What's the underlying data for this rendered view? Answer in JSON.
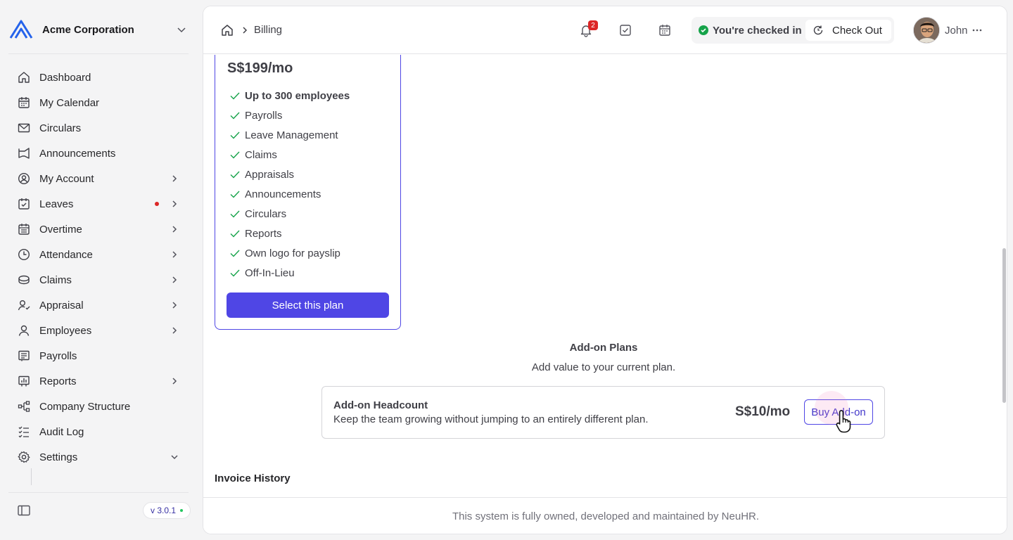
{
  "org": {
    "name": "Acme Corporation"
  },
  "sidebar": {
    "items": [
      {
        "label": "Dashboard",
        "icon": "home-icon"
      },
      {
        "label": "My Calendar",
        "icon": "calendar-icon"
      },
      {
        "label": "Circulars",
        "icon": "mail-icon"
      },
      {
        "label": "Announcements",
        "icon": "megaphone-icon"
      },
      {
        "label": "My Account",
        "icon": "user-circle-icon",
        "has_children": true
      },
      {
        "label": "Leaves",
        "icon": "calendar-check-icon",
        "has_children": true,
        "has_alert": true
      },
      {
        "label": "Overtime",
        "icon": "calendar-grid-icon",
        "has_children": true
      },
      {
        "label": "Attendance",
        "icon": "clock-icon",
        "has_children": true
      },
      {
        "label": "Claims",
        "icon": "coins-icon",
        "has_children": true
      },
      {
        "label": "Appraisal",
        "icon": "user-star-icon",
        "has_children": true
      },
      {
        "label": "Employees",
        "icon": "user-icon",
        "has_children": true
      },
      {
        "label": "Payrolls",
        "icon": "receipt-icon"
      },
      {
        "label": "Reports",
        "icon": "chart-icon",
        "has_children": true
      },
      {
        "label": "Company Structure",
        "icon": "org-chart-icon"
      },
      {
        "label": "Audit Log",
        "icon": "list-check-icon"
      },
      {
        "label": "Settings",
        "icon": "gear-icon",
        "expanded": true
      }
    ],
    "version": "v 3.0.1"
  },
  "header": {
    "breadcrumb": "Billing",
    "notification_count": "2",
    "checkin_status": "You're checked in",
    "checkout_label": "Check Out",
    "user_name": "John"
  },
  "plan": {
    "price": "S$199/mo",
    "features": [
      {
        "label": "Up to 300 employees",
        "bold": true
      },
      {
        "label": "Payrolls"
      },
      {
        "label": "Leave Management"
      },
      {
        "label": "Claims"
      },
      {
        "label": "Appraisals"
      },
      {
        "label": "Announcements"
      },
      {
        "label": "Circulars"
      },
      {
        "label": "Reports"
      },
      {
        "label": "Own logo for payslip"
      },
      {
        "label": "Off-In-Lieu"
      }
    ],
    "select_label": "Select this plan"
  },
  "addons": {
    "title": "Add-on Plans",
    "subtitle": "Add value to your current plan.",
    "items": [
      {
        "name": "Add-on Headcount",
        "description": "Keep the team growing without jumping to an entirely different plan.",
        "price": "S$10/mo",
        "button_label": "Buy Add-on"
      }
    ]
  },
  "invoice": {
    "title": "Invoice History"
  },
  "footer": {
    "text": "This system is fully owned, developed and maintained by NeuHR."
  },
  "colors": {
    "accent": "#4f46e5",
    "success": "#16a34a",
    "alert": "#dc2626"
  }
}
